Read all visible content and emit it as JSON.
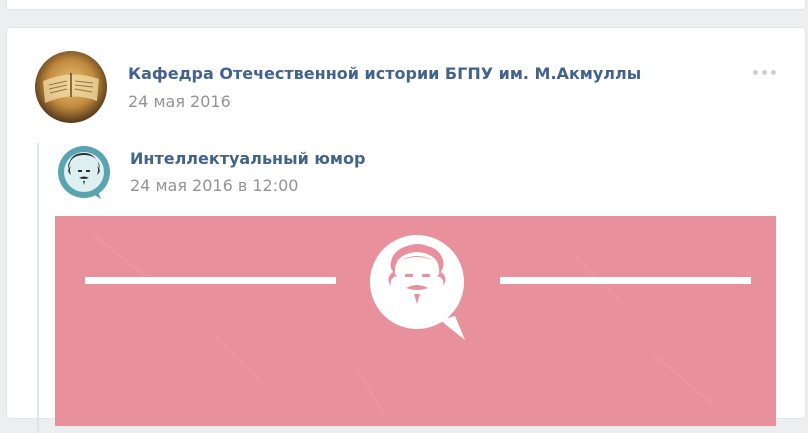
{
  "post": {
    "author": "Кафедра Отечественной истории БГПУ им. М.Акмуллы",
    "date": "24 мая 2016",
    "more_icon": "more-horizontal-icon",
    "avatar_icon": "book-avatar",
    "repost": {
      "author": "Интеллектуальный юмор",
      "date": "24 мая 2016 в 12:00",
      "avatar_icon": "einstein-face-icon",
      "image_icon": "einstein-speech-bubble-icon"
    }
  },
  "colors": {
    "page_bg": "#edeef0",
    "link": "#42648b",
    "meta": "#939393",
    "repost_accent": "#5aa3b1",
    "image_bg": "#e8919c"
  }
}
